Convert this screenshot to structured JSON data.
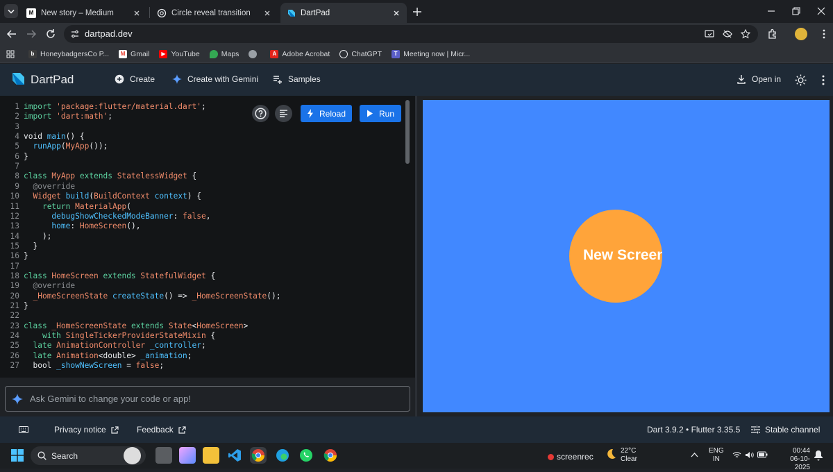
{
  "browser": {
    "tabs": [
      {
        "favicon": "medium-icon",
        "title": "New story – Medium"
      },
      {
        "favicon": "chatgpt-icon",
        "title": "Circle reveal transition"
      },
      {
        "favicon": "dartpad-icon",
        "title": "DartPad"
      }
    ],
    "url": "dartpad.dev",
    "bookmarks": [
      {
        "icon": "honeybadgers-icon",
        "label": "HoneybadgersCo P..."
      },
      {
        "icon": "gmail-icon",
        "label": "Gmail"
      },
      {
        "icon": "youtube-icon",
        "label": "YouTube"
      },
      {
        "icon": "maps-icon",
        "label": "Maps"
      },
      {
        "icon": "globe-icon",
        "label": ""
      },
      {
        "icon": "acrobat-icon",
        "label": "Adobe Acrobat"
      },
      {
        "icon": "chatgpt-icon",
        "label": "ChatGPT"
      },
      {
        "icon": "teams-icon",
        "label": "Meeting now | Micr..."
      }
    ]
  },
  "app": {
    "brand": "DartPad",
    "create": "Create",
    "create_gemini": "Create with Gemini",
    "samples": "Samples",
    "open_in": "Open in"
  },
  "editor": {
    "reload": "Reload",
    "run": "Run",
    "lines": [
      {
        "n": "1",
        "code": [
          [
            "k",
            "import "
          ],
          [
            "s",
            "'package:flutter/material.dart'"
          ],
          [
            "p",
            ";"
          ]
        ]
      },
      {
        "n": "2",
        "code": [
          [
            "k",
            "import "
          ],
          [
            "s",
            "'dart:math'"
          ],
          [
            "p",
            ";"
          ]
        ]
      },
      {
        "n": "3",
        "code": []
      },
      {
        "n": "4",
        "code": [
          [
            "p",
            "void "
          ],
          [
            "f",
            "main"
          ],
          [
            "p",
            "() {"
          ]
        ]
      },
      {
        "n": "5",
        "code": [
          [
            "p",
            "  "
          ],
          [
            "f",
            "runApp"
          ],
          [
            "p",
            "("
          ],
          [
            "t",
            "MyApp"
          ],
          [
            "p",
            "());"
          ]
        ]
      },
      {
        "n": "6",
        "code": [
          [
            "p",
            "}"
          ]
        ]
      },
      {
        "n": "7",
        "code": []
      },
      {
        "n": "8",
        "code": [
          [
            "k",
            "class "
          ],
          [
            "t",
            "MyApp "
          ],
          [
            "k",
            "extends "
          ],
          [
            "t",
            "StatelessWidget "
          ],
          [
            "p",
            "{"
          ]
        ]
      },
      {
        "n": "9",
        "code": [
          [
            "a",
            "  @override"
          ]
        ]
      },
      {
        "n": "10",
        "code": [
          [
            "p",
            "  "
          ],
          [
            "t",
            "Widget "
          ],
          [
            "f",
            "build"
          ],
          [
            "p",
            "("
          ],
          [
            "t",
            "BuildContext "
          ],
          [
            "v",
            "context"
          ],
          [
            "p",
            ") {"
          ]
        ]
      },
      {
        "n": "11",
        "code": [
          [
            "p",
            "    "
          ],
          [
            "k",
            "return "
          ],
          [
            "t",
            "MaterialApp"
          ],
          [
            "p",
            "("
          ]
        ]
      },
      {
        "n": "12",
        "code": [
          [
            "p",
            "      "
          ],
          [
            "v",
            "debugShowCheckedModeBanner"
          ],
          [
            "p",
            ": "
          ],
          [
            "bl",
            "false"
          ],
          [
            "p",
            ","
          ]
        ]
      },
      {
        "n": "13",
        "code": [
          [
            "p",
            "      "
          ],
          [
            "v",
            "home"
          ],
          [
            "p",
            ": "
          ],
          [
            "t",
            "HomeScreen"
          ],
          [
            "p",
            "(),"
          ]
        ]
      },
      {
        "n": "14",
        "code": [
          [
            "p",
            "    );"
          ]
        ]
      },
      {
        "n": "15",
        "code": [
          [
            "p",
            "  }"
          ]
        ]
      },
      {
        "n": "16",
        "code": [
          [
            "p",
            "}"
          ]
        ]
      },
      {
        "n": "17",
        "code": []
      },
      {
        "n": "18",
        "code": [
          [
            "k",
            "class "
          ],
          [
            "t",
            "HomeScreen "
          ],
          [
            "k",
            "extends "
          ],
          [
            "t",
            "StatefulWidget "
          ],
          [
            "p",
            "{"
          ]
        ]
      },
      {
        "n": "19",
        "code": [
          [
            "a",
            "  @override"
          ]
        ]
      },
      {
        "n": "20",
        "code": [
          [
            "p",
            "  "
          ],
          [
            "t",
            "_HomeScreenState "
          ],
          [
            "f",
            "createState"
          ],
          [
            "p",
            "() => "
          ],
          [
            "t",
            "_HomeScreenState"
          ],
          [
            "p",
            "();"
          ]
        ]
      },
      {
        "n": "21",
        "code": [
          [
            "p",
            "}"
          ]
        ]
      },
      {
        "n": "22",
        "code": []
      },
      {
        "n": "23",
        "code": [
          [
            "k",
            "class "
          ],
          [
            "t",
            "_HomeScreenState "
          ],
          [
            "k",
            "extends "
          ],
          [
            "t",
            "State"
          ],
          [
            "p",
            "<"
          ],
          [
            "t",
            "HomeScreen"
          ],
          [
            "p",
            ">"
          ]
        ]
      },
      {
        "n": "24",
        "code": [
          [
            "p",
            "    "
          ],
          [
            "k",
            "with "
          ],
          [
            "t",
            "SingleTickerProviderStateMixin "
          ],
          [
            "p",
            "{"
          ]
        ]
      },
      {
        "n": "25",
        "code": [
          [
            "p",
            "  "
          ],
          [
            "k",
            "late "
          ],
          [
            "t",
            "AnimationController "
          ],
          [
            "v",
            "_controller"
          ],
          [
            "p",
            ";"
          ]
        ]
      },
      {
        "n": "26",
        "code": [
          [
            "p",
            "  "
          ],
          [
            "k",
            "late "
          ],
          [
            "t",
            "Animation"
          ],
          [
            "p",
            "<double> "
          ],
          [
            "v",
            "_animation"
          ],
          [
            "p",
            ";"
          ]
        ]
      },
      {
        "n": "27",
        "code": [
          [
            "p",
            "  bool "
          ],
          [
            "v",
            "_showNewScreen"
          ],
          [
            "p",
            " = "
          ],
          [
            "bl",
            "false"
          ],
          [
            "p",
            ";"
          ]
        ]
      }
    ]
  },
  "ask": {
    "placeholder": "Ask Gemini to change your code or app!"
  },
  "preview": {
    "circle_text": "New Screen",
    "bg_color": "#4188ff",
    "circle_color": "#ffa43a"
  },
  "footer": {
    "privacy": "Privacy notice",
    "feedback": "Feedback",
    "version": "Dart 3.9.2 • Flutter 3.35.5",
    "channel": "Stable channel"
  },
  "taskbar": {
    "search": "Search",
    "screenrec": "screenrec",
    "weather_temp": "22°C",
    "weather_desc": "Clear",
    "lang_top": "ENG",
    "lang_bottom": "IN",
    "time": "00:44",
    "date": "06-10-2025"
  }
}
